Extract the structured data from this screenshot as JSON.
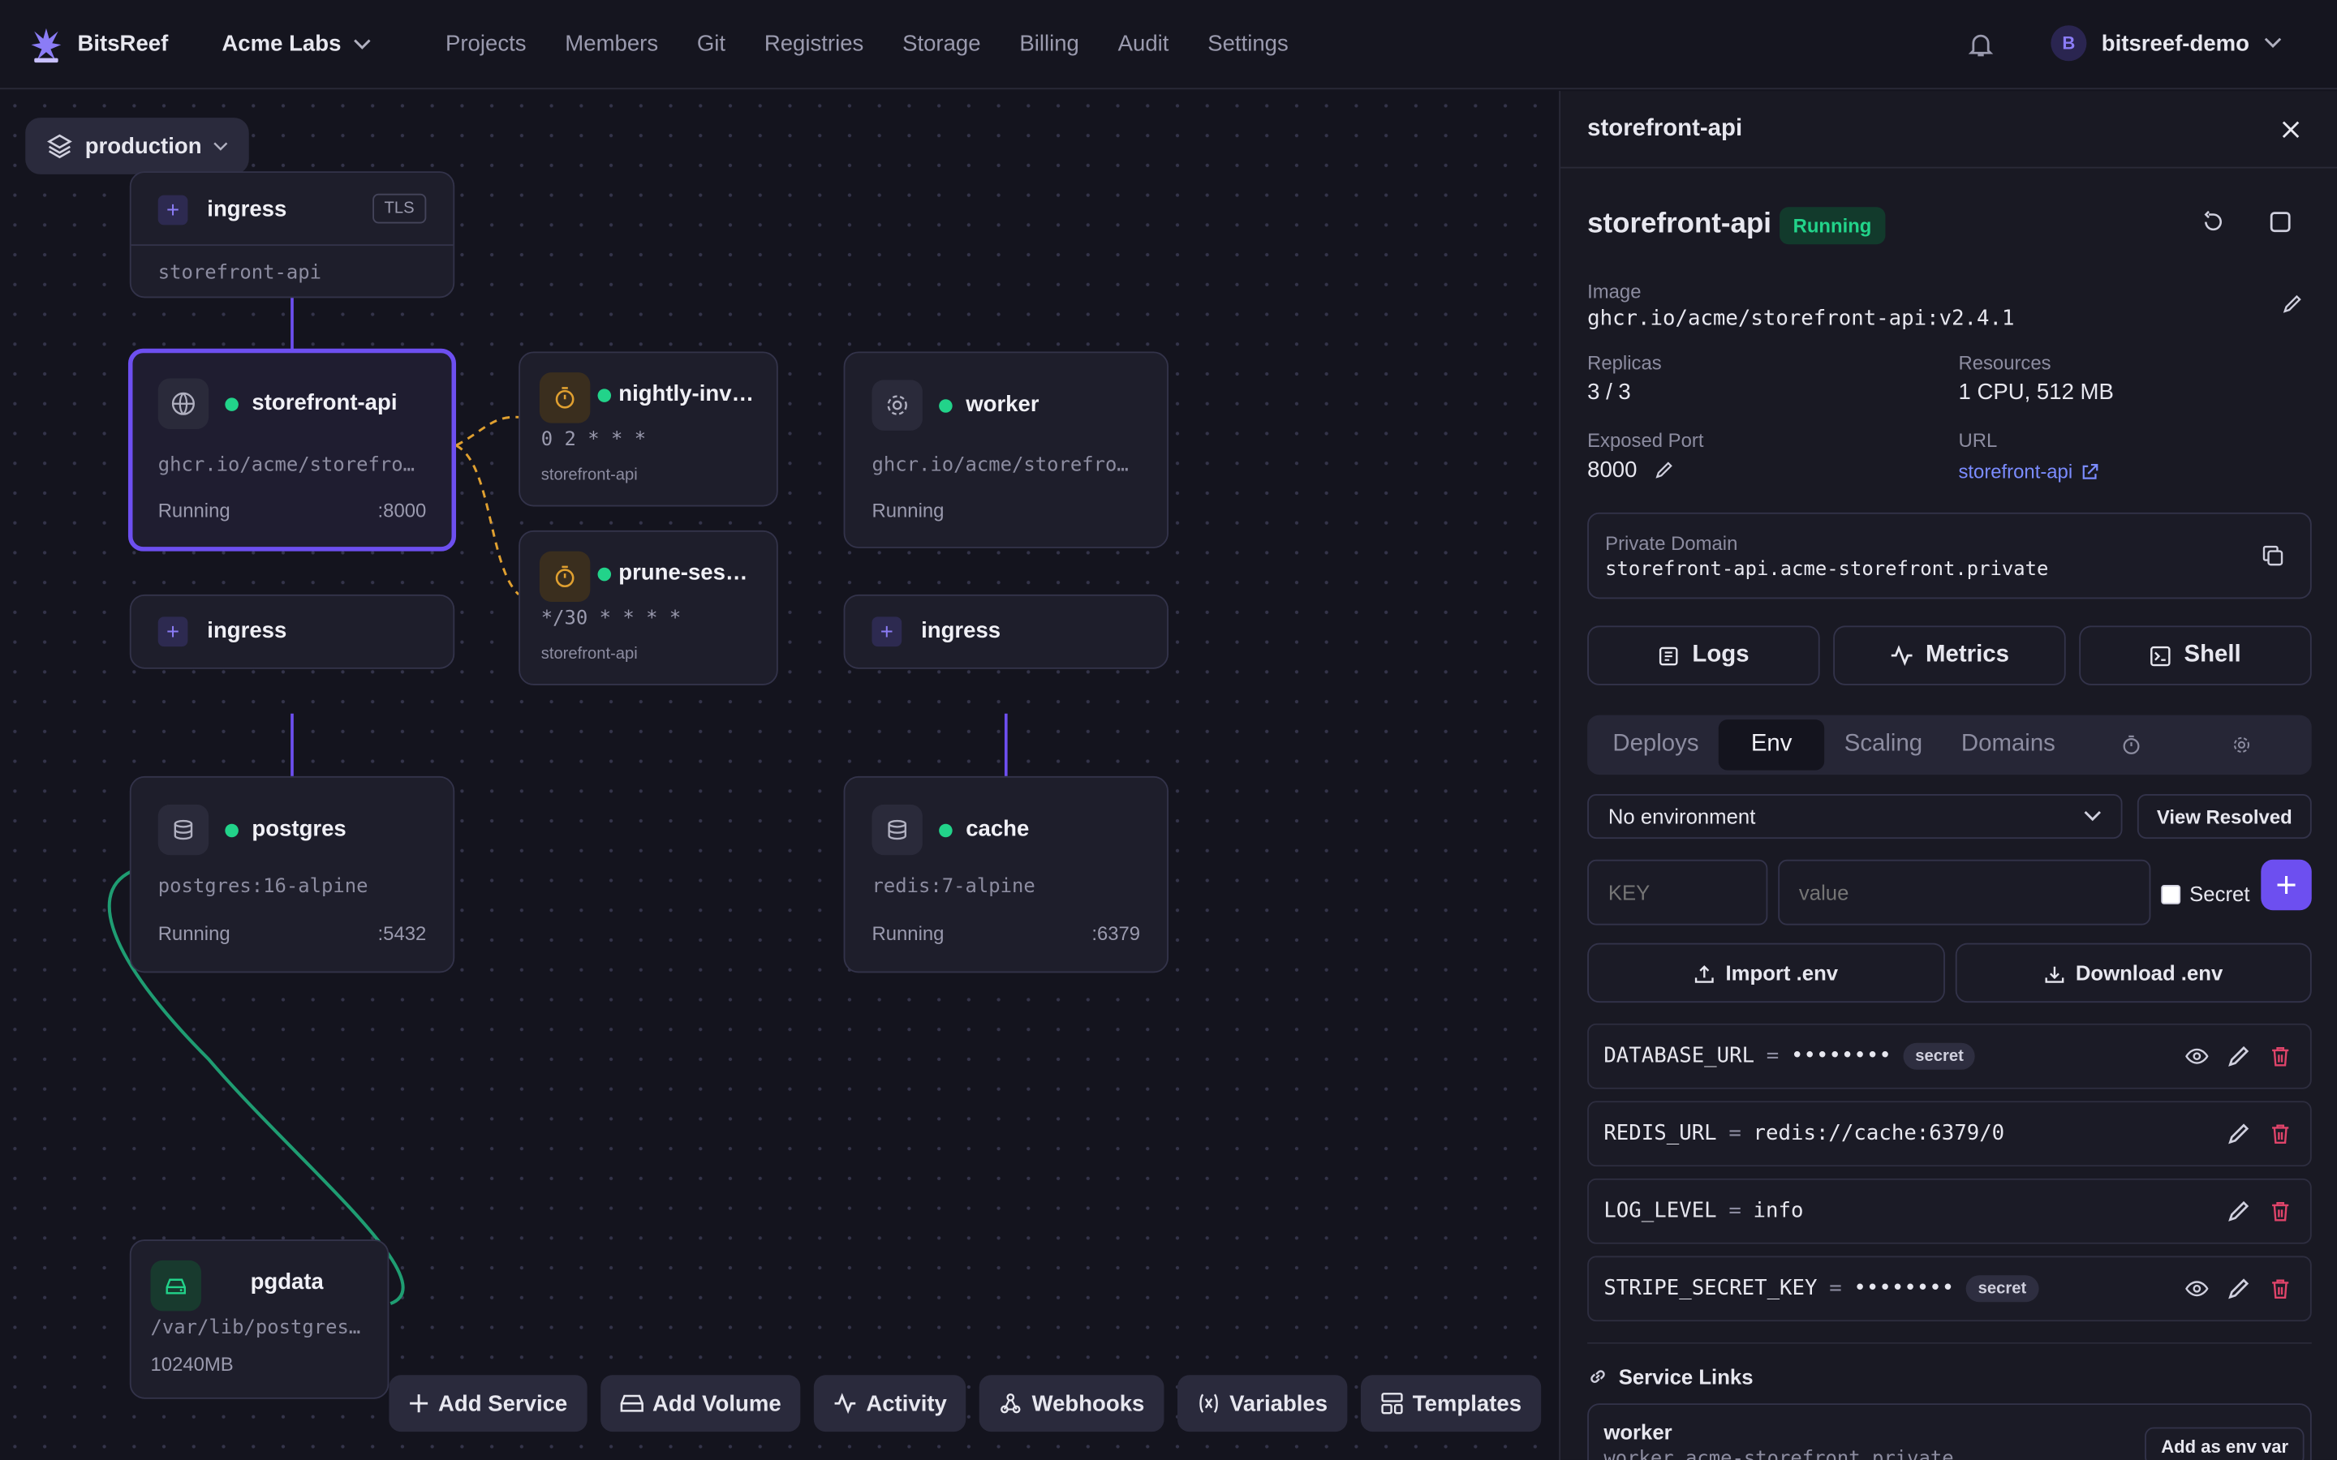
{
  "header": {
    "brand": "BitsReef",
    "org": "Acme Labs",
    "nav": [
      "Projects",
      "Members",
      "Git",
      "Registries",
      "Storage",
      "Billing",
      "Audit",
      "Settings"
    ],
    "user": "bitsreef-demo",
    "avatar_letter": "B"
  },
  "canvas": {
    "environment": "production",
    "nodes": {
      "ingress_top": {
        "title": "ingress",
        "tag": "TLS",
        "target": "storefront-api"
      },
      "storefront": {
        "title": "storefront-api",
        "image": "ghcr.io/acme/storefro…",
        "status": "Running",
        "port": ":8000"
      },
      "nightly": {
        "title": "nightly-inv…",
        "schedule": "0 2 * * *",
        "target": "storefront-api"
      },
      "prune": {
        "title": "prune-ses…",
        "schedule": "*/30 * * * *",
        "target": "storefront-api"
      },
      "worker": {
        "title": "worker",
        "image": "ghcr.io/acme/storefro…",
        "status": "Running"
      },
      "ingress_left": {
        "title": "ingress"
      },
      "ingress_right": {
        "title": "ingress"
      },
      "postgres": {
        "title": "postgres",
        "image": "postgres:16-alpine",
        "status": "Running",
        "port": ":5432"
      },
      "cache": {
        "title": "cache",
        "image": "redis:7-alpine",
        "status": "Running",
        "port": ":6379"
      },
      "pgdata": {
        "title": "pgdata",
        "path": "/var/lib/postgres…",
        "size": "10240MB"
      }
    },
    "toolbar": [
      "Add Service",
      "Add Volume",
      "Activity",
      "Webhooks",
      "Variables",
      "Templates"
    ]
  },
  "panel": {
    "header_title": "storefront-api",
    "service_name": "storefront-api",
    "status": "Running",
    "image_label": "Image",
    "image_value": "ghcr.io/acme/storefront-api:v2.4.1",
    "replicas_label": "Replicas",
    "replicas_value": "3 / 3",
    "resources_label": "Resources",
    "resources_value": "1 CPU, 512 MB",
    "port_label": "Exposed Port",
    "port_value": "8000",
    "url_label": "URL",
    "url_value": "storefront-api",
    "private_domain_label": "Private Domain",
    "private_domain_value": "storefront-api.acme-storefront.private",
    "actions": [
      "Logs",
      "Metrics",
      "Shell"
    ],
    "tabs": [
      "Deploys",
      "Env",
      "Scaling",
      "Domains"
    ],
    "active_tab": "Env",
    "env_select": "No environment",
    "view_resolved": "View Resolved",
    "key_placeholder": "KEY",
    "value_placeholder": "value",
    "secret_label": "Secret",
    "import_label": "Import .env",
    "download_label": "Download .env",
    "env_vars": [
      {
        "key": "DATABASE_URL",
        "value": "••••••••",
        "secret": "secret"
      },
      {
        "key": "REDIS_URL",
        "value": "redis://cache:6379/0"
      },
      {
        "key": "LOG_LEVEL",
        "value": "info"
      },
      {
        "key": "STRIPE_SECRET_KEY",
        "value": "••••••••",
        "secret": "secret"
      }
    ],
    "eq": "=",
    "service_links_title": "Service Links",
    "link": {
      "name": "worker",
      "domain": "worker.acme-storefront.private",
      "action": "Add as env var"
    }
  },
  "colors": {
    "accent": "#6d4ff0",
    "running": "#22d38a",
    "cron": "#e0a030",
    "danger": "#e0446a",
    "link": "#7b8cff"
  }
}
